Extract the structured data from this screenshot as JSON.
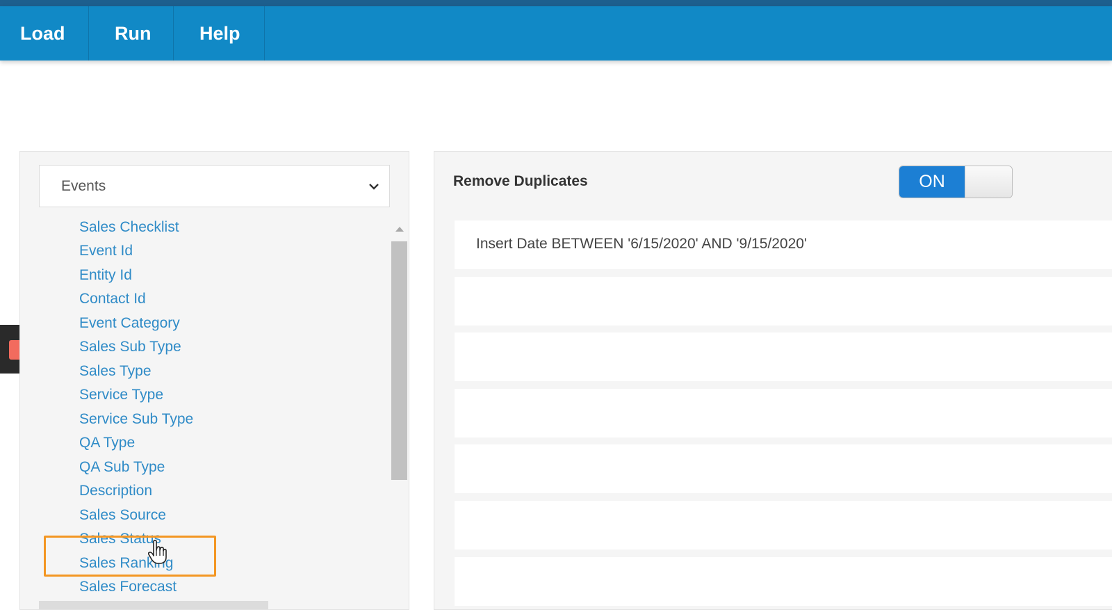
{
  "nav": {
    "items": [
      "Load",
      "Run",
      "Help"
    ]
  },
  "colors": {
    "nav_bg": "#1189c6",
    "link": "#2f8bc7",
    "toggle_on": "#1c7fd4",
    "highlight_border": "#f39623",
    "record": "#f26b5e"
  },
  "left": {
    "select": {
      "value": "Events",
      "icon": "chevron-down-icon"
    },
    "fields": [
      "Sales Checklist",
      "Event Id",
      "Entity Id",
      "Contact Id",
      "Event Category",
      "Sales Sub Type",
      "Sales Type",
      "Service Type",
      "Service Sub Type",
      "QA Type",
      "QA Sub Type",
      "Description",
      "Sales Source",
      "Sales Status",
      "Sales Ranking",
      "Sales Forecast"
    ],
    "selected_index": 13
  },
  "right": {
    "remove_duplicates_label": "Remove Duplicates",
    "toggle_label": "ON",
    "condition_text": "Insert Date BETWEEN '6/15/2020' AND '9/15/2020'"
  }
}
